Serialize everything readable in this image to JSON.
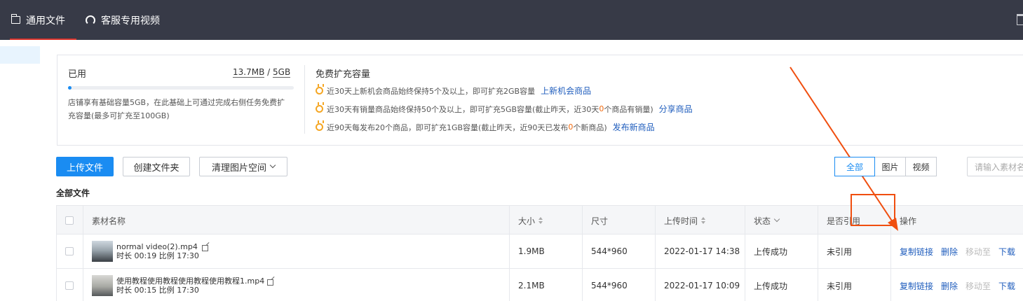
{
  "tabs": [
    {
      "label": "通用文件",
      "icon": "folder-icon",
      "active": true
    },
    {
      "label": "客服专用视频",
      "icon": "headset-icon",
      "active": false
    }
  ],
  "storage": {
    "used_label": "已用",
    "used": "13.7MB",
    "separator": "/",
    "total": "5GB",
    "used_fraction": 0.0027,
    "desc": "店铺享有基础容量5GB，在此基础上可通过完成右侧任务免费扩充容量(最多可扩充至100GB)",
    "free_title": "免费扩充容量",
    "rules": [
      {
        "pre": "近30天上新机会商品始终保持5个及以上，即可扩充2GB容量",
        "hl": "",
        "post": "",
        "link": "上新机会商品"
      },
      {
        "pre": "近30天有销量商品始终保持50个及以上，即可扩充5GB容量(截止昨天，近30天",
        "hl": "0",
        "post": "个商品有销量)",
        "link": "分享商品"
      },
      {
        "pre": "近90天每发布20个商品，即可扩充1GB容量(截止昨天，近90天已发布",
        "hl": "0",
        "post": "个新商品)",
        "link": "发布新商品"
      }
    ]
  },
  "toolbar": {
    "upload": "上传文件",
    "new_folder": "创建文件夹",
    "clean": "清理图片空间",
    "filters": [
      "全部",
      "图片",
      "视频"
    ],
    "active_filter": "全部",
    "search_placeholder": "请输入素材名"
  },
  "section_title": "全部文件",
  "table": {
    "columns": [
      "素材名称",
      "大小",
      "尺寸",
      "上传时间",
      "状态",
      "是否引用",
      "操作"
    ],
    "rows": [
      {
        "name": "normal video(2).mp4",
        "meta": "时长 00:19  比例 17:30",
        "size": "1.9MB",
        "dims": "544*960",
        "time": "2022-01-17 14:38",
        "status": "上传成功",
        "ref": "未引用"
      },
      {
        "name": "使用教程使用教程使用教程使用教程1.mp4",
        "meta": "时长 00:15  比例 17:30",
        "size": "2.1MB",
        "dims": "544*960",
        "time": "2022-01-17 10:09",
        "status": "上传成功",
        "ref": "未引用"
      }
    ],
    "actions": {
      "copy": "复制链接",
      "delete": "删除",
      "move": "移动至",
      "download": "下载"
    }
  },
  "colors": {
    "topbar": "#373a47",
    "accent": "#1a8cf2",
    "highlight": "#f04e0f",
    "link": "#1f5dbd"
  }
}
